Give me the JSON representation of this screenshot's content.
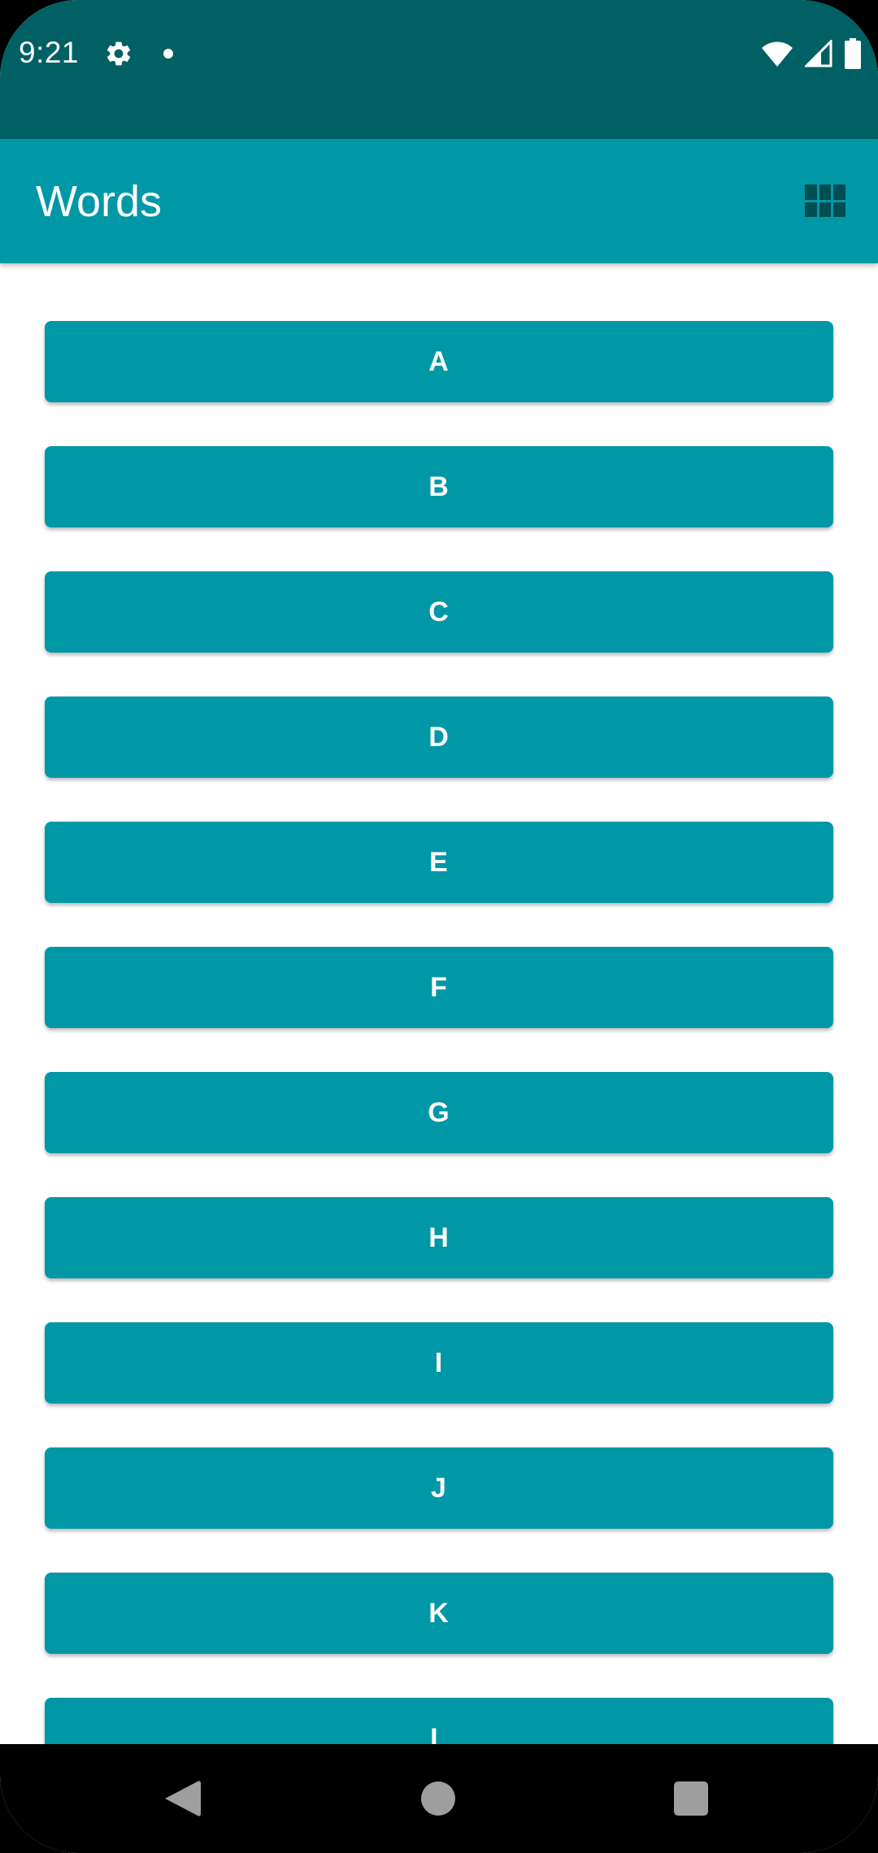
{
  "status_bar": {
    "time": "9:21",
    "icons": [
      "gear-icon",
      "notification-dot-icon",
      "wifi-icon",
      "signal-icon",
      "battery-icon"
    ]
  },
  "app_bar": {
    "title": "Words",
    "action_icon": "grid-layout-icon"
  },
  "letters": [
    "A",
    "B",
    "C",
    "D",
    "E",
    "F",
    "G",
    "H",
    "I",
    "J",
    "K",
    "L"
  ],
  "colors": {
    "status_bar": "#006064",
    "primary": "#0097a7",
    "on_primary": "#ffffff",
    "background": "#ffffff",
    "nav_bar": "#000000"
  },
  "nav_bar": {
    "icons": [
      "back-icon",
      "home-icon",
      "recents-icon"
    ]
  }
}
